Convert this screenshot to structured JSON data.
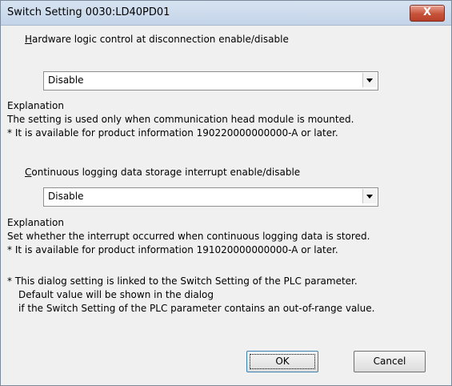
{
  "window": {
    "title": "Switch Setting 0030:LD40PD01",
    "close_label": "X"
  },
  "section1": {
    "label_prefix": "H",
    "label_rest": "ardware logic control at disconnection enable/disable",
    "value": "Disable",
    "explanation_header": "Explanation",
    "explanation_line1": "The setting is used only when communication head module is mounted.",
    "explanation_line2": "* It is available for product information 190220000000000-A or later."
  },
  "section2": {
    "label_prefix": "C",
    "label_rest": "ontinuous logging data storage interrupt enable/disable",
    "value": "Disable",
    "explanation_header": "Explanation",
    "explanation_line1": "Set whether the interrupt occurred when continuous logging data is stored.",
    "explanation_line2": "* It is available for product information 191020000000000-A or later."
  },
  "note": {
    "line1": "* This dialog setting is linked to the Switch Setting of the PLC parameter.",
    "line2": "Default value will be shown in the dialog",
    "line3": "if the Switch Setting of the PLC parameter contains an out-of-range value."
  },
  "buttons": {
    "ok": "OK",
    "cancel": "Cancel"
  }
}
